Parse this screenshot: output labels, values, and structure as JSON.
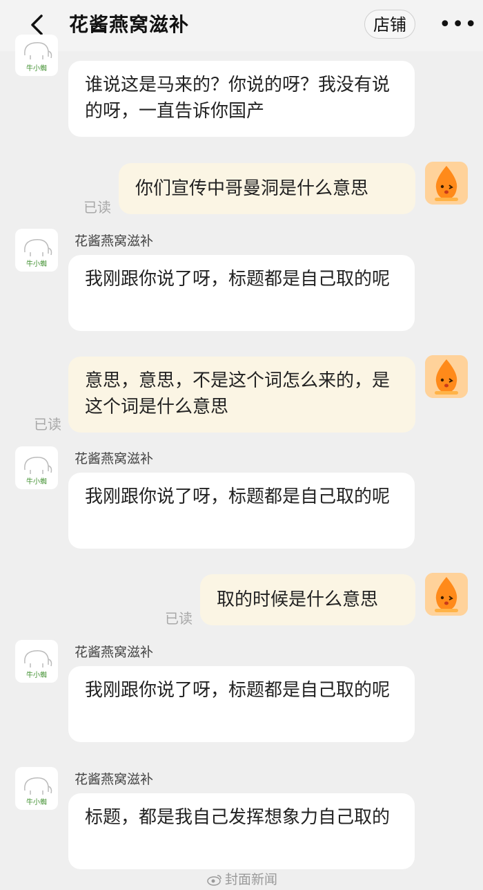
{
  "header": {
    "title": "花酱燕窝滋补",
    "shop_label": "店铺",
    "more_label": "•••"
  },
  "shop_avatar_text": "牛小蜘",
  "messages": [
    {
      "side": "in",
      "sender": "",
      "text": "谁说这是马来的？你说的呀？我没有说的呀，一直告诉你国产"
    },
    {
      "side": "out",
      "text": "你们宣传中哥曼洞是什么意思",
      "status": "已读"
    },
    {
      "side": "in",
      "sender": "花酱燕窝滋补",
      "text": "我刚跟你说了呀，标题都是自己取的呢"
    },
    {
      "side": "out",
      "text": "意思，意思，不是这个词怎么来的，是这个词是什么意思",
      "status": "已读"
    },
    {
      "side": "in",
      "sender": "花酱燕窝滋补",
      "text": "我刚跟你说了呀，标题都是自己取的呢"
    },
    {
      "side": "out",
      "text": "取的时候是什么意思",
      "status": "已读"
    },
    {
      "side": "in",
      "sender": "花酱燕窝滋补",
      "text": "我刚跟你说了呀，标题都是自己取的呢"
    },
    {
      "side": "in",
      "sender": "花酱燕窝滋补",
      "text": "标题，都是我自己发挥想象力自己取的"
    }
  ],
  "watermark": "封面新闻",
  "colors": {
    "background": "#efefef",
    "incoming_bubble": "#ffffff",
    "outgoing_bubble": "#fbf5e4",
    "read_text": "#a8a8a8",
    "avatar_orange": "#ff8a1a"
  }
}
